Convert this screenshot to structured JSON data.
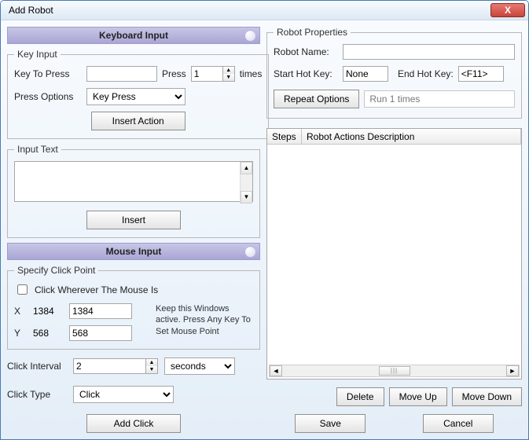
{
  "window": {
    "title": "Add Robot",
    "close": "X"
  },
  "keyboard": {
    "header": "Keyboard Input",
    "key_input_legend": "Key Input",
    "key_to_press_label": "Key To Press",
    "key_to_press_value": "",
    "press_label": "Press",
    "press_count": "1",
    "times_label": "times",
    "press_options_label": "Press Options",
    "press_options_value": "Key Press",
    "insert_action": "Insert Action",
    "input_text_legend": "Input Text",
    "input_text_value": "",
    "insert": "Insert"
  },
  "mouse": {
    "header": "Mouse Input",
    "specify_legend": "Specify Click Point",
    "checkbox_label": "Click Wherever The Mouse Is",
    "x_label": "X",
    "x_static": "1384",
    "x_value": "1384",
    "y_label": "Y",
    "y_static": "568",
    "y_value": "568",
    "hint": "Keep this Windows active. Press Any Key To Set Mouse Point",
    "click_interval_label": "Click Interval",
    "click_interval_value": "2",
    "click_interval_unit": "seconds",
    "click_type_label": "Click Type",
    "click_type_value": "Click",
    "add_click": "Add Click"
  },
  "props": {
    "legend": "Robot Properties",
    "name_label": "Robot Name:",
    "name_value": "",
    "start_hot_label": "Start Hot Key:",
    "start_hot_value": "None",
    "end_hot_label": "End Hot Key:",
    "end_hot_value": "<F11>",
    "repeat_btn": "Repeat Options",
    "repeat_text": "Run 1 times"
  },
  "table": {
    "col_steps": "Steps",
    "col_desc": "Robot Actions Description"
  },
  "actions": {
    "delete": "Delete",
    "move_up": "Move Up",
    "move_down": "Move Down",
    "save": "Save",
    "cancel": "Cancel"
  }
}
